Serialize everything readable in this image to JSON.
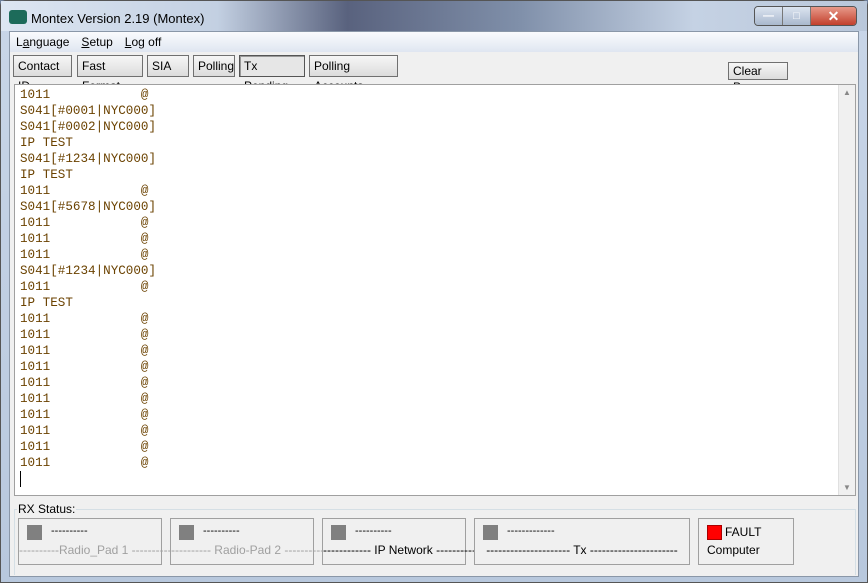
{
  "window": {
    "title": "Montex Version 2.19 (Montex)",
    "minimize": "—",
    "maximize": "□",
    "close": "✕"
  },
  "menu": [
    {
      "label": "Language",
      "key": "a"
    },
    {
      "label": "Setup",
      "key": "S"
    },
    {
      "label": "Log off",
      "key": "L"
    }
  ],
  "toolbar": {
    "tabs": [
      "Contact ID",
      "Fast Format",
      "SIA",
      "Polling",
      "Tx Pending",
      "Polling Accounts"
    ],
    "active": "Tx Pending",
    "clear_page": "Clear Page"
  },
  "log": {
    "lines": [
      "1011            @",
      "S041[#0001|NYC000]",
      "S041[#0002|NYC000]",
      "IP TEST",
      "S041[#1234|NYC000]",
      "IP TEST",
      "1011            @",
      "S041[#5678|NYC000]",
      "1011            @",
      "1011            @",
      "1011            @",
      "S041[#1234|NYC000]",
      "1011            @",
      "IP TEST",
      "1011            @",
      "1011            @",
      "1011            @",
      "1011            @",
      "1011            @",
      "1011            @",
      "1011            @",
      "1011            @",
      "1011            @",
      "1011            @"
    ],
    "text_color": "#6b4200"
  },
  "rx_status": {
    "label": "RX Status:",
    "panels": [
      {
        "status": "----------",
        "name": "----------Radio_Pad 1 ----------",
        "led": "#808080",
        "disabled": true
      },
      {
        "status": "----------",
        "name": "---------- Radio-Pad 2 ----------",
        "led": "#808080",
        "disabled": true
      },
      {
        "status": "----------",
        "name": "------------ IP Network ----------",
        "led": "#808080",
        "disabled": false
      },
      {
        "status": "-------------",
        "name": "--------------------- Tx ----------------------",
        "led": "#808080",
        "disabled": false
      },
      {
        "status": "FAULT",
        "name": "Computer",
        "led": "#ff0000",
        "disabled": false
      }
    ]
  }
}
